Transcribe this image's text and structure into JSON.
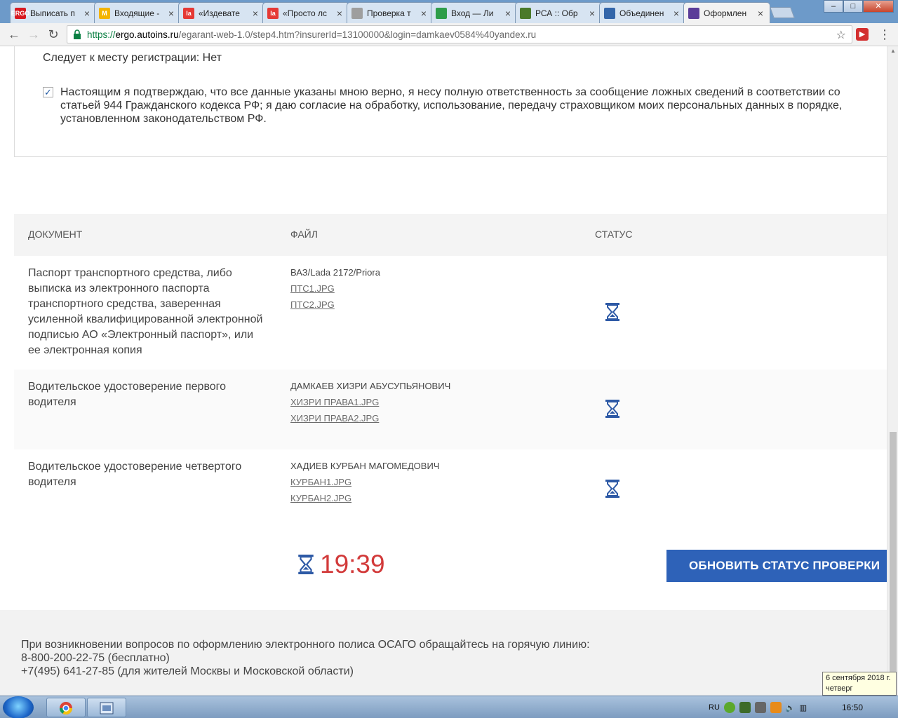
{
  "browser": {
    "tabs": [
      {
        "title": "Выписать п",
        "fav_color": "#d71920",
        "fav_text": "ERGO"
      },
      {
        "title": "Входящие -",
        "fav_color": "#f4b400",
        "fav_text": "M"
      },
      {
        "title": "«Издевате",
        "fav_color": "#e53935",
        "fav_text": "la"
      },
      {
        "title": "«Просто лс",
        "fav_color": "#e53935",
        "fav_text": "la"
      },
      {
        "title": "Проверка т",
        "fav_color": "#9e9e9e",
        "fav_text": ""
      },
      {
        "title": "Вход — Ли",
        "fav_color": "#2e9d4a",
        "fav_text": ""
      },
      {
        "title": "РСА :: Обр",
        "fav_color": "#4a7a2a",
        "fav_text": ""
      },
      {
        "title": "Объединен",
        "fav_color": "#3366aa",
        "fav_text": ""
      },
      {
        "title": "Оформлен",
        "fav_color": "#5b3d99",
        "fav_text": ""
      }
    ],
    "url_scheme": "https://",
    "url_host": "ergo.autoins.ru",
    "url_path": "/egarant-web-1.0/step4.htm?insurerId=13100000&login=damkaev0584%40yandex.ru"
  },
  "summary": {
    "registration_line": "Следует к месту регистрации: Нет",
    "consent_checked": true,
    "consent_text": "Настоящим я подтверждаю, что все данные указаны мною верно, я несу полную ответственность за сообщение ложных сведений в соответствии со статьей 944 Гражданского кодекса РФ; я даю согласие на обработку, использование, передачу страховщиком моих персональных данных в порядке, установленном законодательством РФ."
  },
  "documents": {
    "headers": {
      "document": "Документ",
      "file": "Файл",
      "status": "Статус"
    },
    "rows": [
      {
        "name": "Паспорт транспортного средства, либо выписка из электронного паспорта транспортного средства, заверенная усиленной квалифицированной электронной подписью АО «Электронный паспорт», или ее электронная копия",
        "owner": "ВАЗ/Lada 2172/Priora",
        "files": [
          "ПТС1.JPG",
          "ПТС2.JPG"
        ],
        "status": "pending"
      },
      {
        "name": "Водительское удостоверение первого водителя",
        "owner": "ДАМКАЕВ ХИЗРИ АБУСУПЬЯНОВИЧ",
        "files": [
          "ХИЗРИ ПРАВА1.JPG",
          "ХИЗРИ ПРАВА2.JPG"
        ],
        "status": "pending"
      },
      {
        "name": "Водительское удостоверение четвертого водителя",
        "owner": "ХАДИЕВ КУРБАН МАГОМЕДОВИЧ",
        "files": [
          "КУРБАН1.JPG",
          "КУРБАН2.JPG"
        ],
        "status": "pending"
      }
    ]
  },
  "timer": {
    "value": "19:39",
    "color": "#d23a3a"
  },
  "refresh_button": {
    "label": "Обновить статус проверки",
    "color": "#2e62b8"
  },
  "footer": {
    "line1": "При возникновении вопросов по оформлению электронного полиса ОСАГО обращайтесь на горячую линию:",
    "line2": "8-800-200-22-75 (бесплатно)",
    "line3": "+7(495) 641-27-85 (для жителей Москвы и Московской области)"
  },
  "taskbar": {
    "language": "RU",
    "time": "16:50",
    "tooltip_date": "6 сентября 2018 г.",
    "tooltip_day": "четверг"
  }
}
